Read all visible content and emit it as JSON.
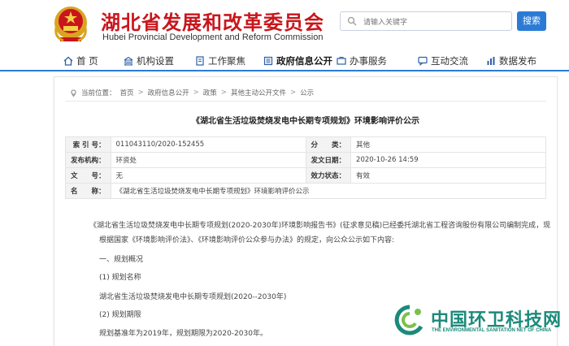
{
  "header": {
    "title_cn": "湖北省发展和改革委员会",
    "title_en": "Hubei Provincial Development and Reform Commission",
    "search_placeholder": "请输入关键字",
    "search_label": "搜索"
  },
  "nav": {
    "items": [
      {
        "label": "首 页",
        "icon": "home-icon"
      },
      {
        "label": "机构设置",
        "icon": "building-icon"
      },
      {
        "label": "工作聚焦",
        "icon": "document-icon"
      },
      {
        "label": "政府信息公开",
        "icon": "book-icon"
      },
      {
        "label": "办事服务",
        "icon": "service-icon"
      },
      {
        "label": "互动交流",
        "icon": "chat-icon"
      },
      {
        "label": "数据发布",
        "icon": "chart-icon"
      }
    ]
  },
  "breadcrumb": {
    "prefix": "当前位置：",
    "items": [
      "首页",
      "政府信息公开",
      "政策",
      "其他主动公开文件",
      "公示"
    ]
  },
  "document": {
    "title": "《湖北省生活垃圾焚烧发电中长期专项规划》环境影响评价公示",
    "meta": {
      "index_label": "索 引 号：",
      "index_value": "011043110/2020-152455",
      "category_label": "分　　类：",
      "category_value": "其他",
      "publisher_label": "发布机构：",
      "publisher_value": "环资处",
      "date_label": "发文日期：",
      "date_value": "2020-10-26 14:59",
      "docno_label": "文　　号：",
      "docno_value": "无",
      "status_label": "效力状态：",
      "status_value": "有效",
      "name_label": "名　　称：",
      "name_value": "《湖北省生活垃圾焚烧发电中长期专项规划》环境影响评价公示"
    },
    "paragraphs": [
      "《湖北省生活垃圾焚烧发电中长期专项规划(2020-2030年)环境影响报告书》(征求意见稿)已经委托湖北省工程咨询股份有限公司编制完成，现",
      "根据国家《环境影响评价法》、《环境影响评价公众参与办法》的规定，向公众公示如下内容:",
      "一、规划概况",
      "(1) 规划名称",
      "湖北省生活垃圾焚烧发电中长期专项规划(2020--2030年)",
      "(2) 规划期限",
      "规划基准年为2019年，规划期限为2020-2030年。"
    ]
  },
  "watermark": {
    "cn": "中国环卫科技网",
    "en": "THE ENVIRONMENTAL SANITATION NET OF CHINA"
  }
}
